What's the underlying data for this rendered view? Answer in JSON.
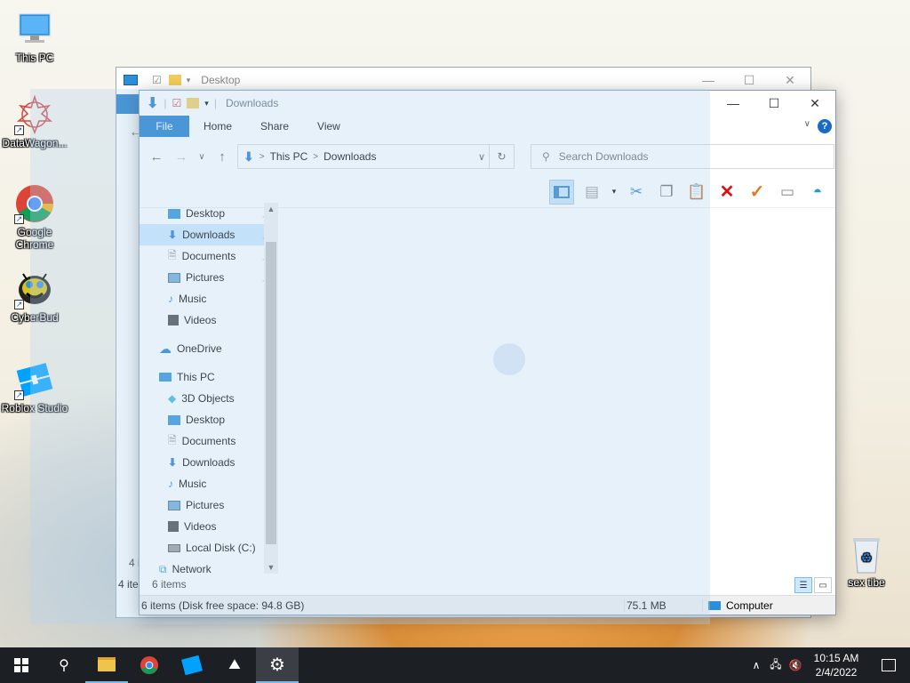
{
  "desktop": {
    "icons": [
      {
        "label": "This PC",
        "icon": "monitor-icon"
      },
      {
        "label": "DataWagon...",
        "icon": "datawagon-icon"
      },
      {
        "label": "Google Chrome",
        "icon": "chrome-icon"
      },
      {
        "label": "CyberBud",
        "icon": "cyberbud-icon"
      },
      {
        "label": "Roblox Studio",
        "icon": "roblox-icon"
      },
      {
        "label": "sex tibe",
        "icon": "recycle-bin-icon"
      }
    ]
  },
  "back_window": {
    "title": "Desktop",
    "items_count": "4 ite",
    "items_count2": "4 i"
  },
  "window": {
    "title": "Downloads",
    "tabs": [
      "File",
      "Home",
      "Share",
      "View"
    ],
    "help": "?",
    "address": {
      "root": "This PC",
      "sep": ">",
      "current": "Downloads"
    },
    "search_placeholder": "Search Downloads",
    "nav": {
      "quick_access": [
        {
          "label": "Desktop",
          "pinned": true
        },
        {
          "label": "Downloads",
          "pinned": true,
          "selected": true
        },
        {
          "label": "Documents",
          "pinned": true
        },
        {
          "label": "Pictures",
          "pinned": true
        },
        {
          "label": "Music"
        },
        {
          "label": "Videos"
        }
      ],
      "onedrive": "OneDrive",
      "this_pc": "This PC",
      "this_pc_items": [
        "3D Objects",
        "Desktop",
        "Documents",
        "Downloads",
        "Music",
        "Pictures",
        "Videos",
        "Local Disk (C:)"
      ],
      "network": "Network"
    },
    "items_count": "6 items",
    "status": {
      "left": "6 items (Disk free space: 94.8 GB)",
      "size": "75.1 MB",
      "location": "Computer"
    }
  },
  "taskbar": {
    "time": "10:15 AM",
    "date": "2/4/2022"
  }
}
